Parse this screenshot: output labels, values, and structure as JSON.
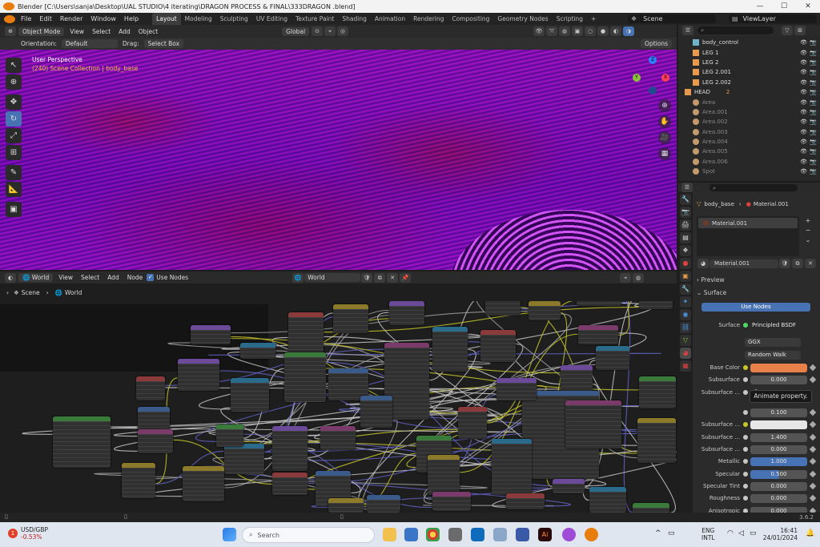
{
  "window": {
    "title": "Blender [C:\\Users\\sanja\\Desktop\\UAL STUDIO\\4 iterating\\DRAGON PROCESS & FINAL\\333DRAGON .blend]"
  },
  "menu": [
    "File",
    "Edit",
    "Render",
    "Window",
    "Help"
  ],
  "workspaces": [
    "Layout",
    "Modeling",
    "Sculpting",
    "UV Editing",
    "Texture Paint",
    "Shading",
    "Animation",
    "Rendering",
    "Compositing",
    "Geometry Nodes",
    "Scripting"
  ],
  "active_workspace": "Layout",
  "scene": {
    "name": "Scene",
    "view_layer": "ViewLayer"
  },
  "viewport_header": {
    "mode": "Object Mode",
    "menus": [
      "View",
      "Select",
      "Add",
      "Object"
    ],
    "transform": "Global",
    "orientation_label": "Orientation:",
    "orientation": "Default",
    "drag_label": "Drag:",
    "drag": "Select Box",
    "options": "Options"
  },
  "viewport": {
    "perspective": "User Perspective",
    "collection": "(240) Scene Collection | body_base",
    "gizmo": {
      "x": "X",
      "y": "Y",
      "z": "Z"
    }
  },
  "outliner": {
    "items": [
      {
        "name": "body_control",
        "type": "armature"
      },
      {
        "name": "LEG 1",
        "type": "mesh"
      },
      {
        "name": "LEG 2",
        "type": "mesh"
      },
      {
        "name": "LEG 2.001",
        "type": "mesh"
      },
      {
        "name": "LEG 2.002",
        "type": "mesh"
      },
      {
        "name": "HEAD",
        "type": "mesh",
        "badge": "2"
      },
      {
        "name": "Area",
        "type": "light"
      },
      {
        "name": "Area.001",
        "type": "light"
      },
      {
        "name": "Area.002",
        "type": "light"
      },
      {
        "name": "Area.003",
        "type": "light"
      },
      {
        "name": "Area.004",
        "type": "light"
      },
      {
        "name": "Area.005",
        "type": "light"
      },
      {
        "name": "Area.006",
        "type": "light"
      },
      {
        "name": "Spot",
        "type": "light"
      }
    ]
  },
  "properties": {
    "breadcrumb_object": "body_base",
    "breadcrumb_material": "Material.001",
    "slot": "Material.001",
    "material_name": "Material.001",
    "panel_preview": "Preview",
    "panel_surface": "Surface",
    "use_nodes": "Use Nodes",
    "surface_label": "Surface",
    "surface_value": "Principled BSDF",
    "distribution": "GGX",
    "subsurface_method": "Random Walk",
    "tooltip": "Animate property.",
    "rows": [
      {
        "label": "Base Color",
        "value": "",
        "kind": "color",
        "color": "#e8804a"
      },
      {
        "label": "Subsurface",
        "value": "0.000",
        "kind": "number"
      },
      {
        "label": "Subsurface ...",
        "value": "",
        "kind": "tooltip-row"
      },
      {
        "label": "",
        "value": "0.100",
        "kind": "number"
      },
      {
        "label": "Subsurface ...",
        "value": "",
        "kind": "color",
        "color": "#e6e6e6"
      },
      {
        "label": "Subsurface ...",
        "value": "1.400",
        "kind": "number"
      },
      {
        "label": "Subsurface ...",
        "value": "0.000",
        "kind": "number"
      },
      {
        "label": "Metallic",
        "value": "1.000",
        "kind": "slider",
        "fill": 1.0
      },
      {
        "label": "Specular",
        "value": "0.500",
        "kind": "slider",
        "fill": 0.5
      },
      {
        "label": "Specular Tint",
        "value": "0.000",
        "kind": "number"
      },
      {
        "label": "Roughness",
        "value": "0.000",
        "kind": "number"
      },
      {
        "label": "Anisotropic",
        "value": "0.000",
        "kind": "number"
      }
    ]
  },
  "node_editor": {
    "header_menus": [
      "View",
      "Select",
      "Add",
      "Node"
    ],
    "editor_type": "World",
    "use_nodes": "Use Nodes",
    "world_name": "World",
    "breadcrumb": [
      "Scene",
      "World"
    ]
  },
  "status": {
    "version": "3.6.2"
  },
  "taskbar": {
    "ticker": "USD/GBP",
    "ticker_change": "-0.53%",
    "ticker_badge": "1",
    "search_placeholder": "Search",
    "lang": "ENG",
    "layout": "INTL",
    "time": "16:41",
    "date": "24/01/2024"
  }
}
